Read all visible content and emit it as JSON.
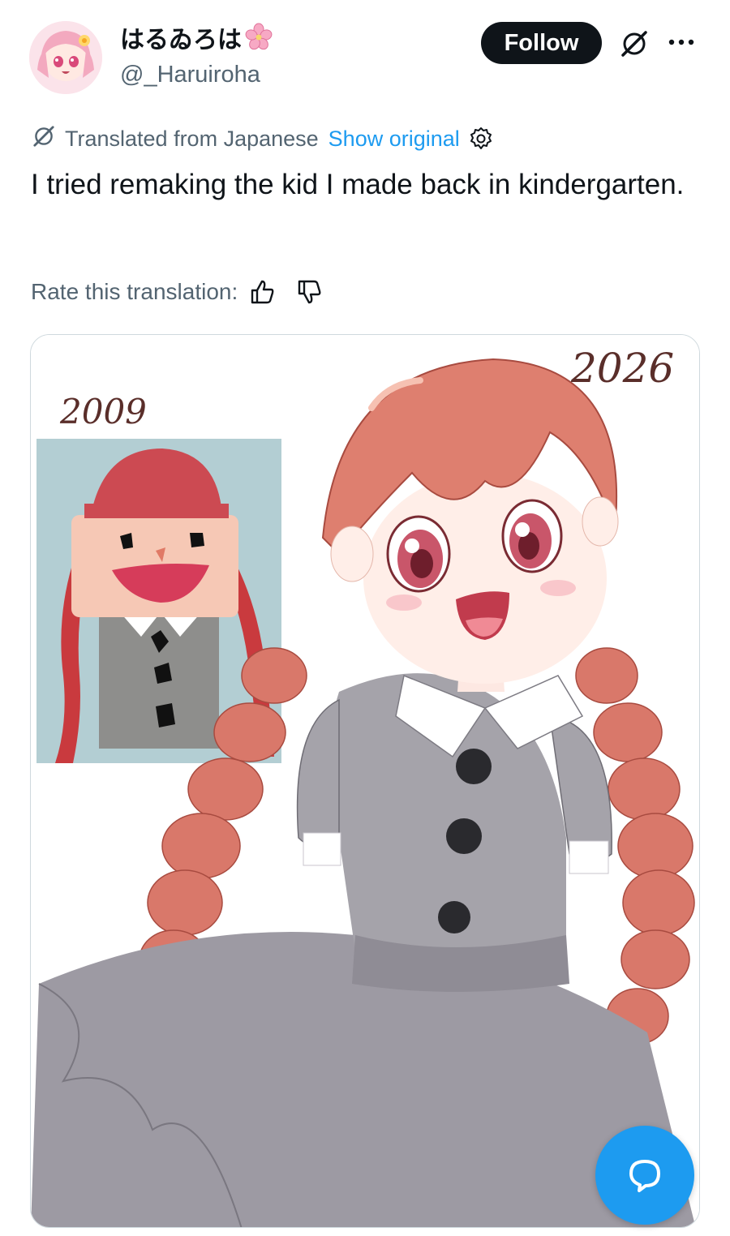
{
  "author": {
    "display_name": "はるゐろは",
    "handle": "@_Haruiroha",
    "avatar_icon": "avatar-anime-girl",
    "name_emoji_icon": "cherry-blossom-icon"
  },
  "actions": {
    "follow_label": "Follow",
    "grok_icon": "grok-icon",
    "more_icon": "more-dots-icon"
  },
  "translation": {
    "source_label": "Translated from Japanese",
    "show_original_label": "Show original",
    "settings_icon": "gear-icon"
  },
  "post": {
    "text": "I tried remaking the kid I made back in kindergarten."
  },
  "rating": {
    "label": "Rate this translation:",
    "up_icon": "thumbs-up-icon",
    "down_icon": "thumbs-down-icon"
  },
  "media": {
    "year_before": "2009",
    "year_after": "2026"
  },
  "fab": {
    "icon": "reply-bubble-icon"
  },
  "colors": {
    "accent": "#1d9bf0",
    "text": "#0f1419",
    "muted": "#536471",
    "border": "#cfd9de"
  }
}
